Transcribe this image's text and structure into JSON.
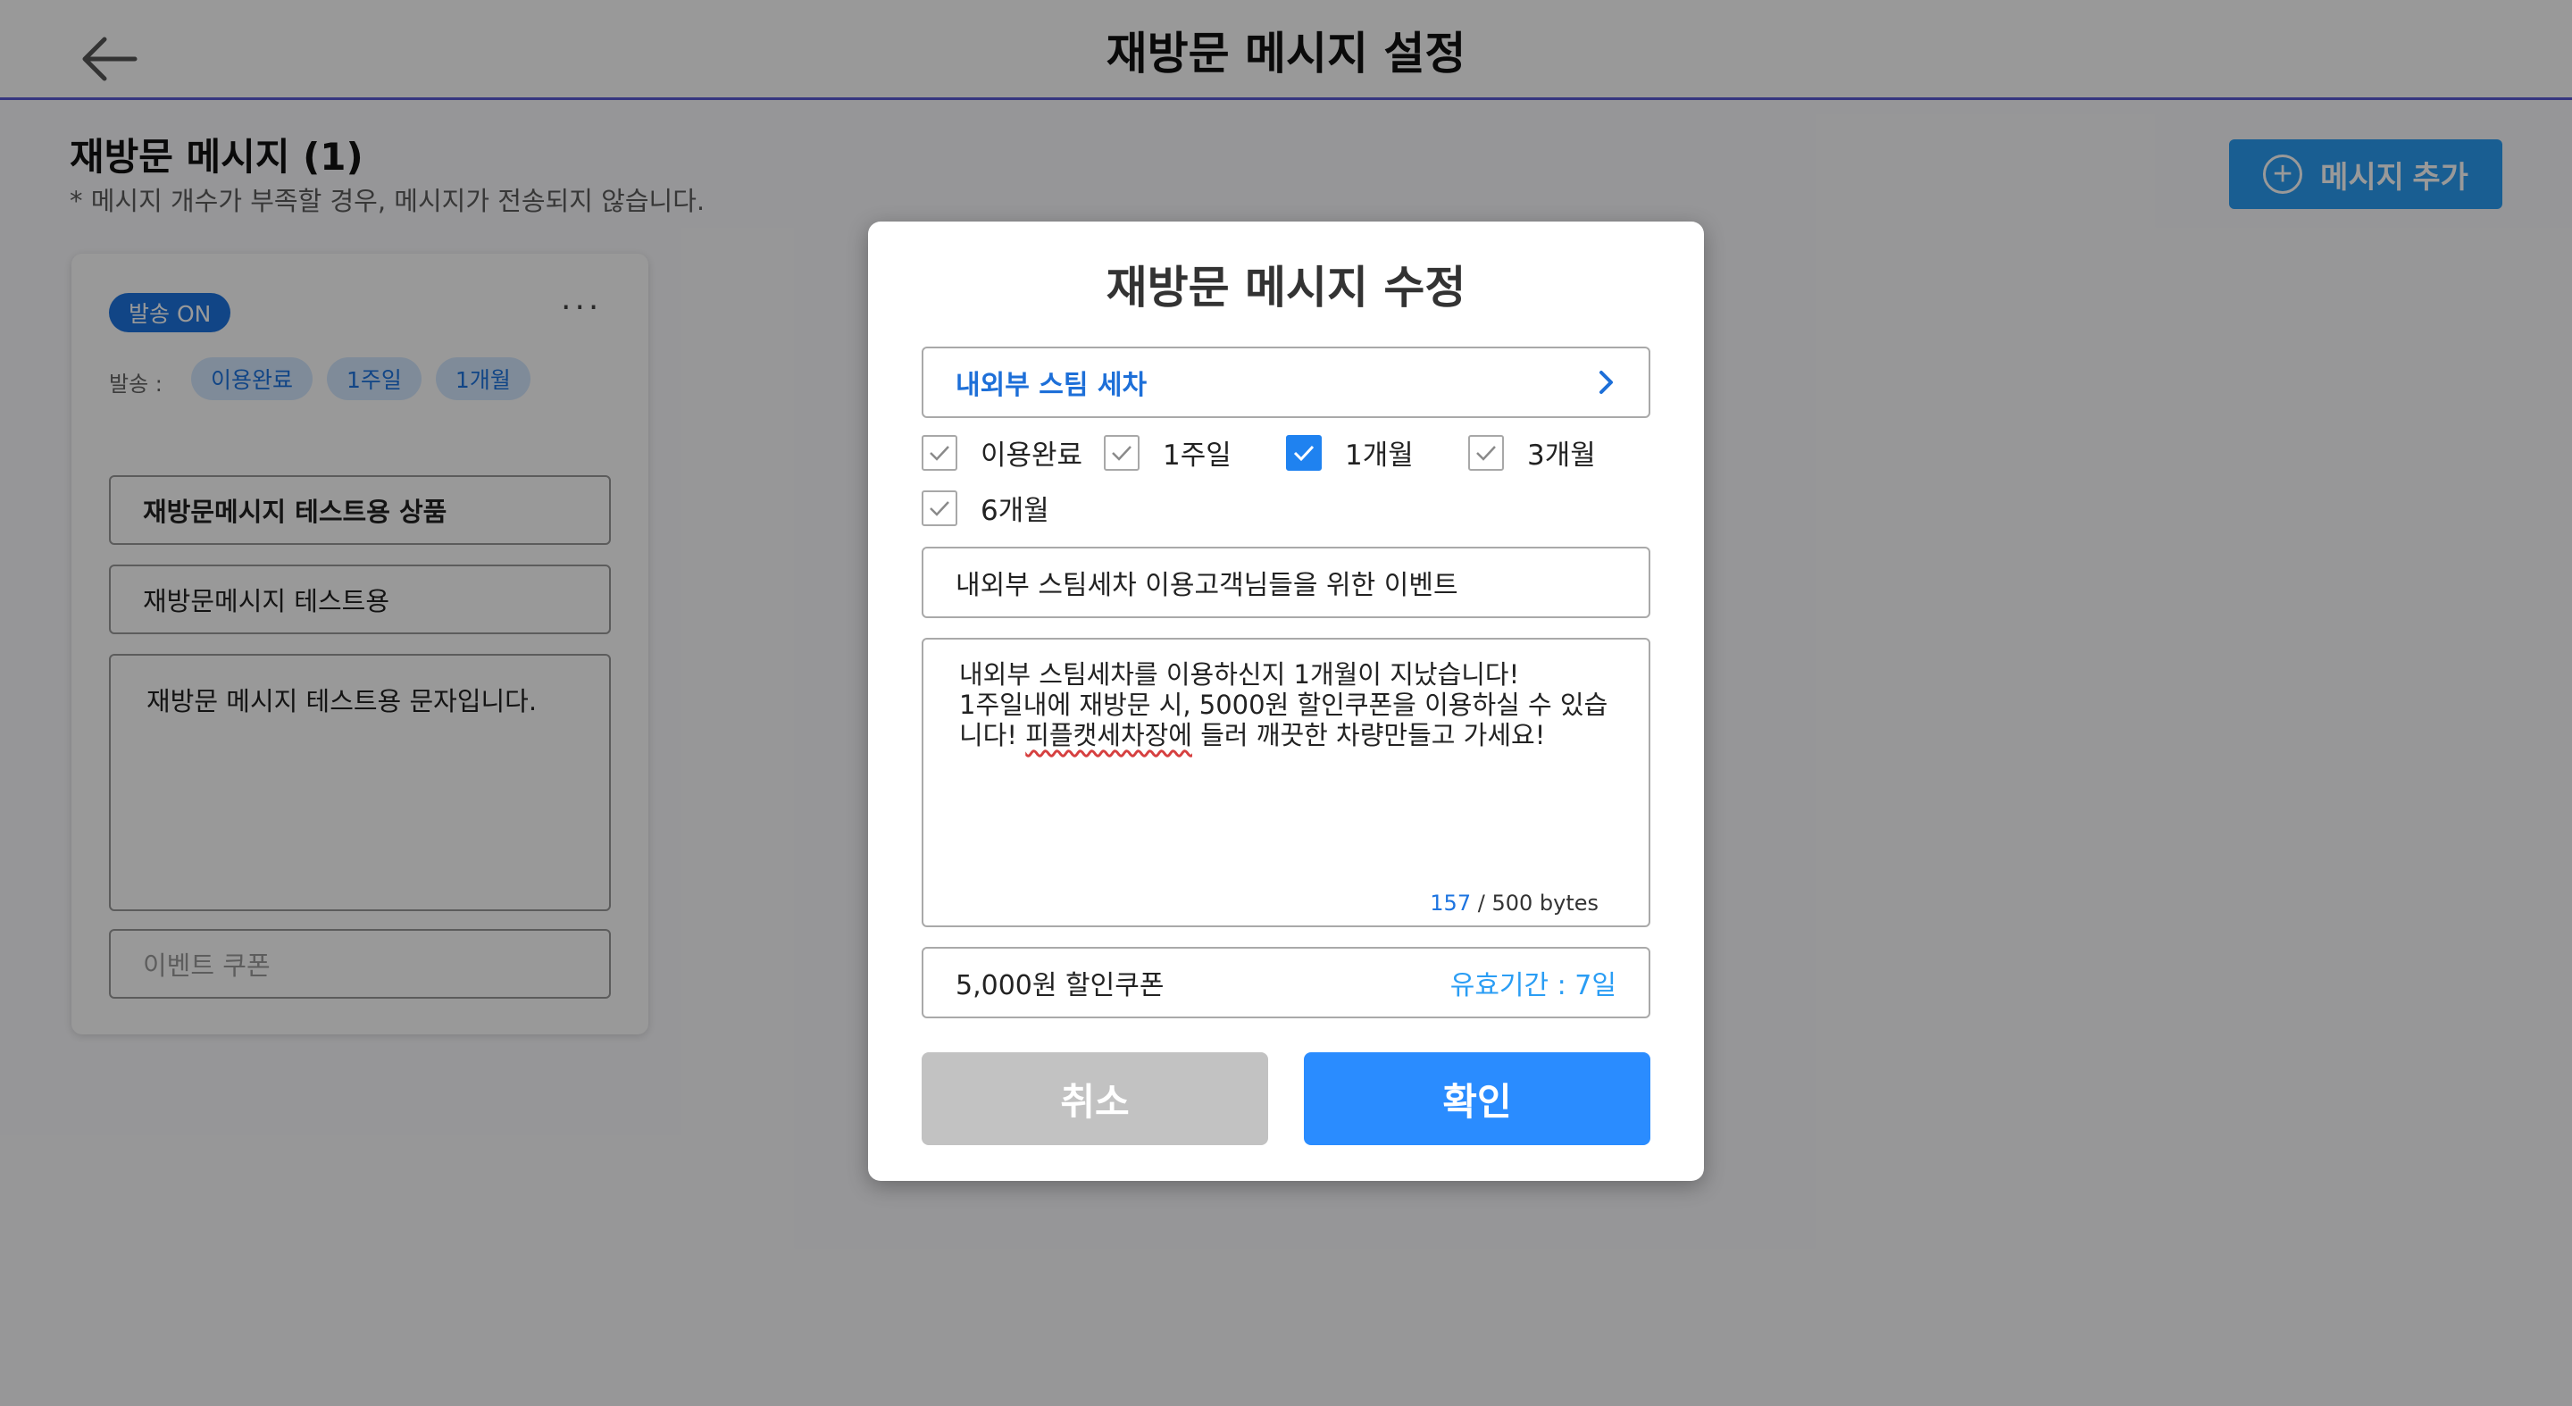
{
  "header": {
    "title": "재방문 메시지 설정",
    "back_icon": "arrow-left-icon"
  },
  "section": {
    "title": "재방문 메시지 (1)",
    "note": "* 메시지 개수가 부족할 경우, 메시지가 전송되지 않습니다."
  },
  "add_button": {
    "label": "메시지 추가",
    "icon": "plus-circle-icon"
  },
  "card": {
    "badge": "발송 ON",
    "more": "···",
    "send_label": "발송 :",
    "chips": [
      "이용완료",
      "1주일",
      "1개월"
    ],
    "product": "재방문메시지 테스트용 상품",
    "title": "재방문메시지 테스트용",
    "body": "재방문 메시지 테스트용 문자입니다.",
    "coupon_placeholder": "이벤트 쿠폰"
  },
  "modal": {
    "title": "재방문 메시지 수정",
    "product": "내외부 스팀 세차",
    "checks": [
      {
        "label": "이용완료",
        "checked": false
      },
      {
        "label": "1주일",
        "checked": false
      },
      {
        "label": "1개월",
        "checked": true
      },
      {
        "label": "3개월",
        "checked": false
      },
      {
        "label": "6개월",
        "checked": false
      }
    ],
    "message_title": "내외부 스팀세차 이용고객님들을 위한 이벤트",
    "body_line1": "내외부 스팀세차를 이용하신지 1개월이 지났습니다!",
    "body_line2": "1주일내에 재방문 시, 5000원 할인쿠폰을 이용하실 수 있습",
    "body_line3_a": "니다! ",
    "body_line3_b": "피플캣세차장에",
    "body_line3_c": " 들러 깨끗한 차량만들고 가세요!",
    "byte_count": "157",
    "byte_limit": " / 500 bytes",
    "coupon": "5,000원 할인쿠폰",
    "validity": "유효기간 : 7일",
    "cancel": "취소",
    "confirm": "확인"
  },
  "colors": {
    "accent": "#2a8cff",
    "badge": "#1d74e0",
    "header_line": "#5b5bd6"
  }
}
